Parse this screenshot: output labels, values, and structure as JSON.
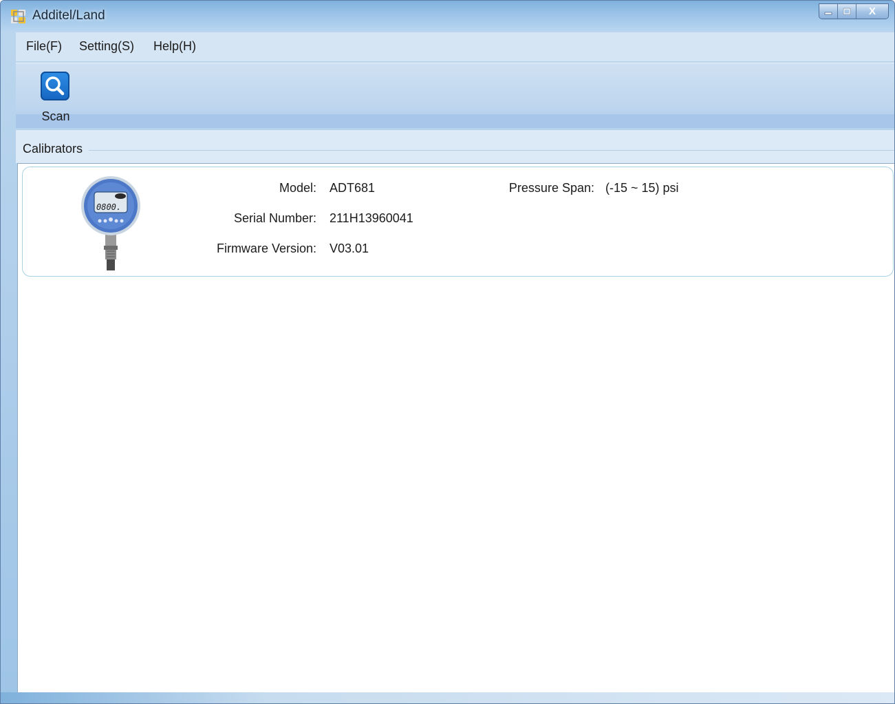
{
  "window": {
    "title": "Additel/Land",
    "controls": {
      "minimize_icon": "minimize-icon",
      "maximize_icon": "maximize-icon",
      "close_glyph": "X"
    }
  },
  "menu": {
    "items": [
      {
        "label": "File(F)"
      },
      {
        "label": "Setting(S)"
      },
      {
        "label": "Help(H)"
      }
    ]
  },
  "toolbar": {
    "scan": {
      "label": "Scan",
      "icon": "search-icon"
    }
  },
  "calibrators": {
    "group_label": "Calibrators",
    "devices": [
      {
        "image_icon": "pressure-gauge-image",
        "gauge_display": "0800.",
        "fields": {
          "model_label": "Model:",
          "model_value": "ADT681",
          "serial_label": "Serial Number:",
          "serial_value": "211H13960041",
          "firmware_label": "Firmware Version:",
          "firmware_value": "V03.01",
          "pressure_label": "Pressure Span:",
          "pressure_value": "(-15 ~ 15) psi"
        }
      }
    ]
  },
  "colors": {
    "accent": "#1565c0",
    "card_border": "#a9d3e5"
  }
}
